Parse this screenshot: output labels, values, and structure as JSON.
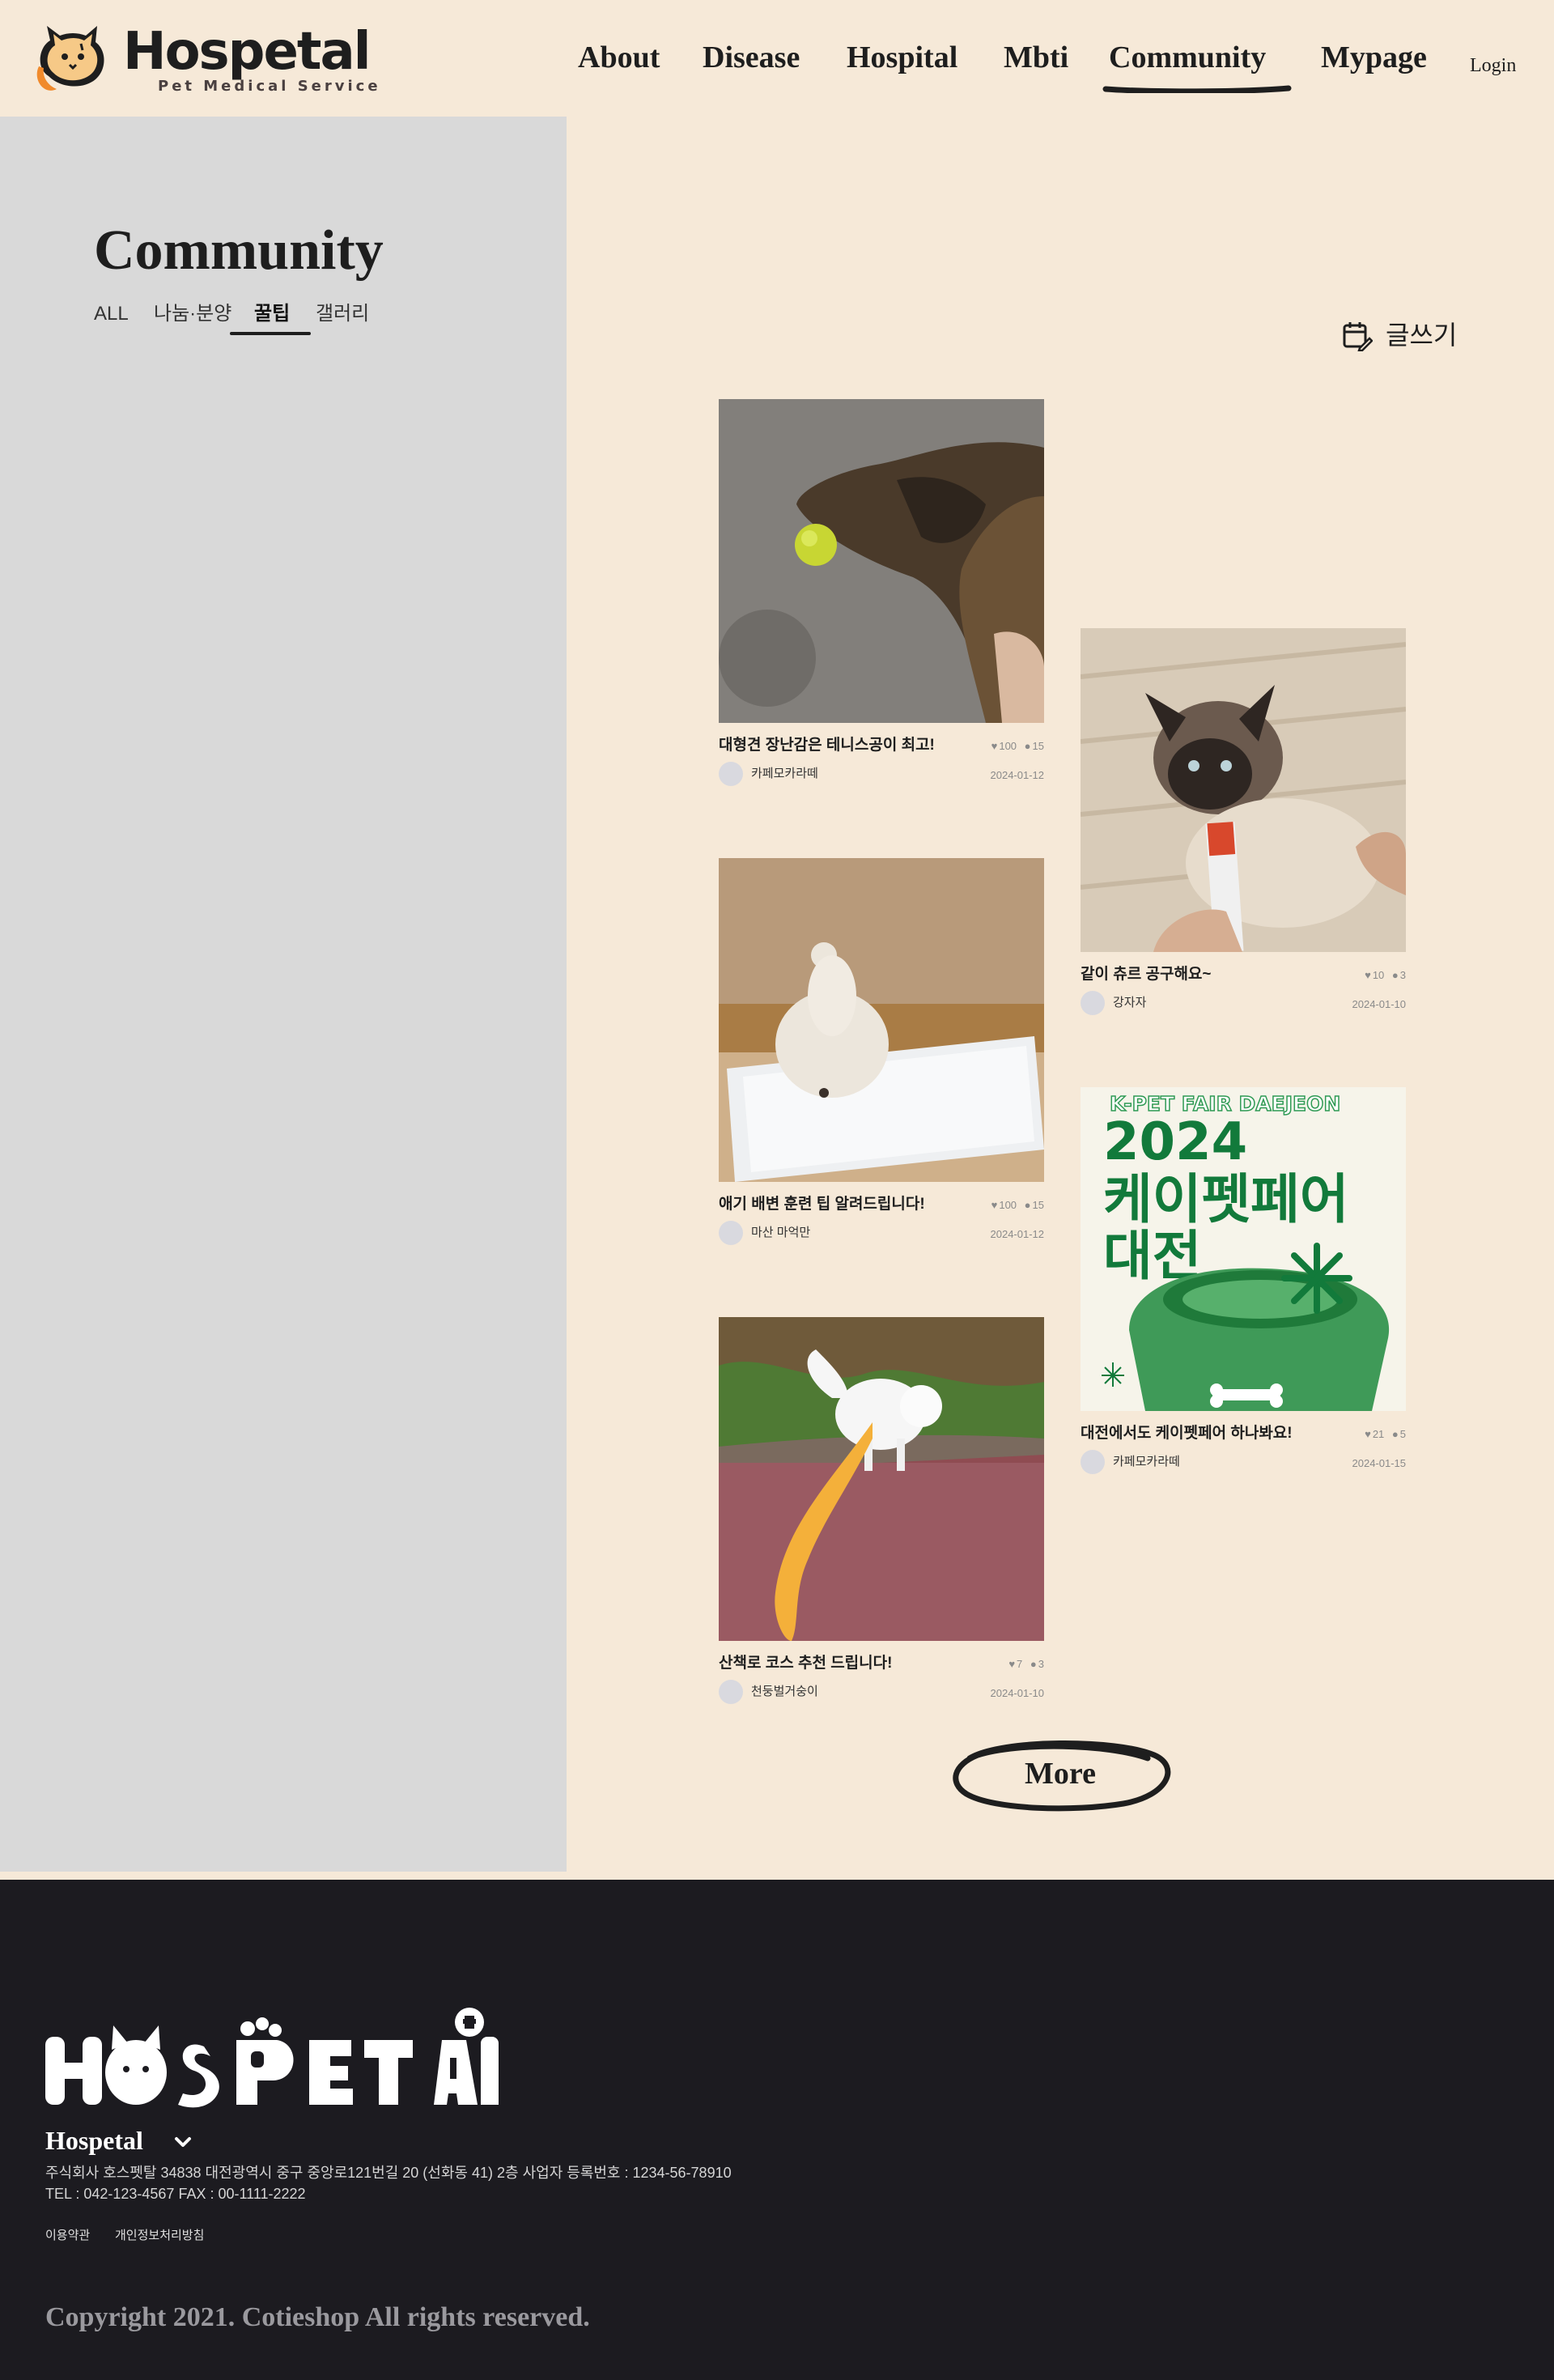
{
  "brand": {
    "logo_text": "Hospetal",
    "tagline": "Pet Medical Service",
    "colors": {
      "cream": "#f6e9d8",
      "sidebar": "#d9d9d9",
      "footer": "#1c1b20",
      "accent_orange": "#f08a2c",
      "ink": "#1e1e1e"
    }
  },
  "nav": {
    "items": [
      {
        "label": "About"
      },
      {
        "label": "Disease"
      },
      {
        "label": "Hospital"
      },
      {
        "label": "Mbti"
      },
      {
        "label": "Community",
        "active": true
      },
      {
        "label": "Mypage"
      }
    ],
    "login": "Login"
  },
  "sidebar": {
    "title": "Community",
    "tabs": [
      {
        "label": "ALL"
      },
      {
        "label": "나눔·분양"
      },
      {
        "label": "꿀팁",
        "active": true
      },
      {
        "label": "갤러리"
      }
    ]
  },
  "write_button": {
    "label": "글쓰기",
    "icon": "calendar-edit-icon"
  },
  "posts": [
    {
      "title": "대형견 장난감은 테니스공이 최고!",
      "likes": "100",
      "comments": "15",
      "author": "카페모카라떼",
      "date": "2024-01-12",
      "image": "dog-with-tennis-ball"
    },
    {
      "title": "같이 츄르 공구해요~",
      "likes": "10",
      "comments": "3",
      "author": "강자자",
      "date": "2024-01-10",
      "image": "cat-eating-churu"
    },
    {
      "title": "애기 배변 훈련 팁 알려드립니다!",
      "likes": "100",
      "comments": "15",
      "author": "마산 마억만",
      "date": "2024-01-12",
      "image": "puppy-on-pee-pad"
    },
    {
      "title": "대전에서도 케이펫페어 하나봐요!",
      "likes": "21",
      "comments": "5",
      "author": "카페모카라떼",
      "date": "2024-01-15",
      "image": "kpet-fair-poster",
      "poster": {
        "top": "K-PET FAIR DAEJEON",
        "year": "2024",
        "line1": "케이펫페어",
        "line2": "대전"
      }
    },
    {
      "title": "산책로 코스 추천 드립니다!",
      "likes": "7",
      "comments": "3",
      "author": "천둥벌거숭이",
      "date": "2024-01-10",
      "image": "white-dog-on-walk"
    }
  ],
  "more_button": "More",
  "footer": {
    "company": "Hospetal",
    "address": "주식회사 호스펫탈 34838 대전광역시 중구 중앙로121번길 20 (선화동 41) 2층  사업자 등록번호 : 1234-56-78910",
    "contact": "TEL : 042-123-4567 FAX : 00-1111-2222",
    "links": [
      "이용약관",
      "개인정보처리방침"
    ],
    "copyright": "Copyright 2021. Cotieshop All rights reserved."
  }
}
